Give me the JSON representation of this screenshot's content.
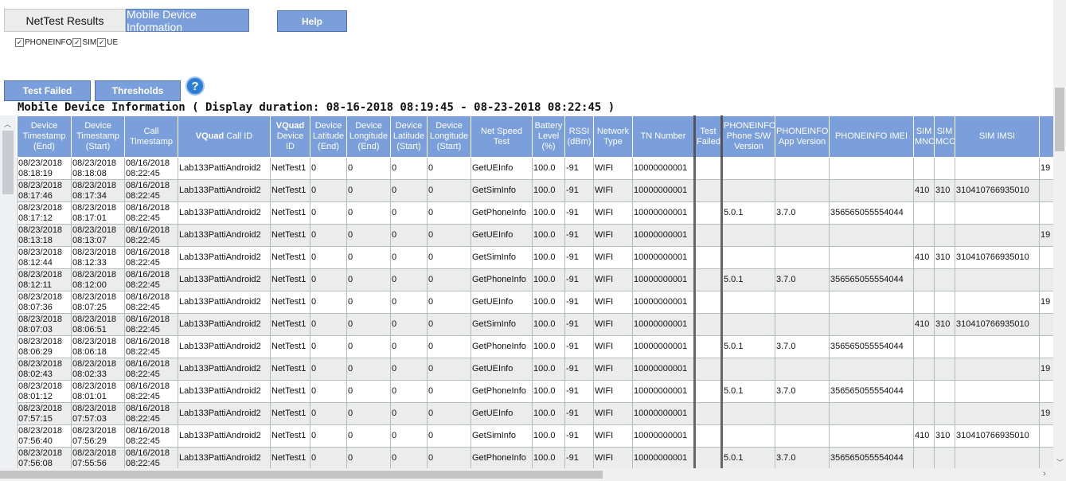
{
  "tabs": {
    "results": "NetTest Results",
    "mobile": "Mobile Device Information"
  },
  "help_label": "Help",
  "filters": [
    {
      "label": "PHONEINFO",
      "checked": true
    },
    {
      "label": "SIM",
      "checked": true
    },
    {
      "label": "UE",
      "checked": true
    }
  ],
  "buttons": {
    "test_failed": "Test Failed",
    "thresholds": "Thresholds"
  },
  "help_icon_glyph": "?",
  "section_title": "Mobile Device Information ( Display duration: 08-16-2018 08:19:45 - 08-23-2018 08:22:45 )",
  "scroll_glyphs": {
    "up": "︿",
    "down": "﹀",
    "right": "›"
  },
  "columns": {
    "dev_ts_end": "Device Timestamp (End)",
    "dev_ts_start": "Device Timestamp (Start)",
    "call_ts": "Call Timestamp",
    "vquad_strong": "VQuad",
    "call_id_rest": " Call ID",
    "vquad_device_rest": " Device ID",
    "lat_end": "Device Latitude (End)",
    "lon_end": "Device Longitude (End)",
    "lat_start": "Device Latitude (Start)",
    "lon_start": "Device Longitude (Start)",
    "net_speed": "Net Speed Test",
    "battery": "Battery Level (%)",
    "rssi": "RSSI (dBm)",
    "network": "Network Type",
    "tn": "TN Number",
    "test_failed": "Test Failed",
    "phone_sw": "PHONEINFO Phone S/W Version",
    "app_ver": "PHONEINFO App Version",
    "imei": "PHONEINFO IMEI",
    "sim_mnc": "SIM MNC",
    "sim_mcc": "SIM MCC",
    "sim_imsi": "SIM IMSI"
  },
  "rows": [
    [
      "08/23/2018 08:18:19",
      "08/23/2018 08:18:08",
      "08/16/2018 08:22:45",
      "Lab133PattiAndroid2",
      "NetTest1",
      "0",
      "0",
      "0",
      "0",
      "GetUEInfo",
      "100.0",
      "-91",
      "WIFI",
      "10000000001",
      "",
      "",
      "",
      "",
      "",
      "",
      "",
      "19"
    ],
    [
      "08/23/2018 08:17:46",
      "08/23/2018 08:17:34",
      "08/16/2018 08:22:45",
      "Lab133PattiAndroid2",
      "NetTest1",
      "0",
      "0",
      "0",
      "0",
      "GetSimInfo",
      "100.0",
      "-91",
      "WIFI",
      "10000000001",
      "",
      "",
      "",
      "",
      "410",
      "310",
      "310410766935010",
      ""
    ],
    [
      "08/23/2018 08:17:12",
      "08/23/2018 08:17:01",
      "08/16/2018 08:22:45",
      "Lab133PattiAndroid2",
      "NetTest1",
      "0",
      "0",
      "0",
      "0",
      "GetPhoneInfo",
      "100.0",
      "-91",
      "WIFI",
      "10000000001",
      "",
      "5.0.1",
      "3.7.0",
      "356565055554044",
      "",
      "",
      "",
      ""
    ],
    [
      "08/23/2018 08:13:18",
      "08/23/2018 08:13:07",
      "08/16/2018 08:22:45",
      "Lab133PattiAndroid2",
      "NetTest1",
      "0",
      "0",
      "0",
      "0",
      "GetUEInfo",
      "100.0",
      "-91",
      "WIFI",
      "10000000001",
      "",
      "",
      "",
      "",
      "",
      "",
      "",
      "19"
    ],
    [
      "08/23/2018 08:12:44",
      "08/23/2018 08:12:33",
      "08/16/2018 08:22:45",
      "Lab133PattiAndroid2",
      "NetTest1",
      "0",
      "0",
      "0",
      "0",
      "GetSimInfo",
      "100.0",
      "-91",
      "WIFI",
      "10000000001",
      "",
      "",
      "",
      "",
      "410",
      "310",
      "310410766935010",
      ""
    ],
    [
      "08/23/2018 08:12:11",
      "08/23/2018 08:12:00",
      "08/16/2018 08:22:45",
      "Lab133PattiAndroid2",
      "NetTest1",
      "0",
      "0",
      "0",
      "0",
      "GetPhoneInfo",
      "100.0",
      "-91",
      "WIFI",
      "10000000001",
      "",
      "5.0.1",
      "3.7.0",
      "356565055554044",
      "",
      "",
      "",
      ""
    ],
    [
      "08/23/2018 08:07:36",
      "08/23/2018 08:07:25",
      "08/16/2018 08:22:45",
      "Lab133PattiAndroid2",
      "NetTest1",
      "0",
      "0",
      "0",
      "0",
      "GetUEInfo",
      "100.0",
      "-91",
      "WIFI",
      "10000000001",
      "",
      "",
      "",
      "",
      "",
      "",
      "",
      "19"
    ],
    [
      "08/23/2018 08:07:03",
      "08/23/2018 08:06:51",
      "08/16/2018 08:22:45",
      "Lab133PattiAndroid2",
      "NetTest1",
      "0",
      "0",
      "0",
      "0",
      "GetSimInfo",
      "100.0",
      "-91",
      "WIFI",
      "10000000001",
      "",
      "",
      "",
      "",
      "410",
      "310",
      "310410766935010",
      ""
    ],
    [
      "08/23/2018 08:06:29",
      "08/23/2018 08:06:18",
      "08/16/2018 08:22:45",
      "Lab133PattiAndroid2",
      "NetTest1",
      "0",
      "0",
      "0",
      "0",
      "GetPhoneInfo",
      "100.0",
      "-91",
      "WIFI",
      "10000000001",
      "",
      "5.0.1",
      "3.7.0",
      "356565055554044",
      "",
      "",
      "",
      ""
    ],
    [
      "08/23/2018 08:02:43",
      "08/23/2018 08:02:33",
      "08/16/2018 08:22:45",
      "Lab133PattiAndroid2",
      "NetTest1",
      "0",
      "0",
      "0",
      "0",
      "GetUEInfo",
      "100.0",
      "-91",
      "WIFI",
      "10000000001",
      "",
      "",
      "",
      "",
      "",
      "",
      "",
      "19"
    ],
    [
      "08/23/2018 08:01:12",
      "08/23/2018 08:01:01",
      "08/16/2018 08:22:45",
      "Lab133PattiAndroid2",
      "NetTest1",
      "0",
      "0",
      "0",
      "0",
      "GetPhoneInfo",
      "100.0",
      "-91",
      "WIFI",
      "10000000001",
      "",
      "5.0.1",
      "3.7.0",
      "356565055554044",
      "",
      "",
      "",
      ""
    ],
    [
      "08/23/2018 07:57:15",
      "08/23/2018 07:57:03",
      "08/16/2018 08:22:45",
      "Lab133PattiAndroid2",
      "NetTest1",
      "0",
      "0",
      "0",
      "0",
      "GetUEInfo",
      "100.0",
      "-91",
      "WIFI",
      "10000000001",
      "",
      "",
      "",
      "",
      "",
      "",
      "",
      "19"
    ],
    [
      "08/23/2018 07:56:40",
      "08/23/2018 07:56:29",
      "08/16/2018 08:22:45",
      "Lab133PattiAndroid2",
      "NetTest1",
      "0",
      "0",
      "0",
      "0",
      "GetSimInfo",
      "100.0",
      "-91",
      "WIFI",
      "10000000001",
      "",
      "",
      "",
      "",
      "410",
      "310",
      "310410766935010",
      ""
    ],
    [
      "08/23/2018 07:56:08",
      "08/23/2018 07:55:56",
      "08/16/2018 08:22:45",
      "Lab133PattiAndroid2",
      "NetTest1",
      "0",
      "0",
      "0",
      "0",
      "GetPhoneInfo",
      "100.0",
      "-91",
      "WIFI",
      "10000000001",
      "",
      "5.0.1",
      "3.7.0",
      "356565055554044",
      "",
      "",
      "",
      ""
    ]
  ]
}
